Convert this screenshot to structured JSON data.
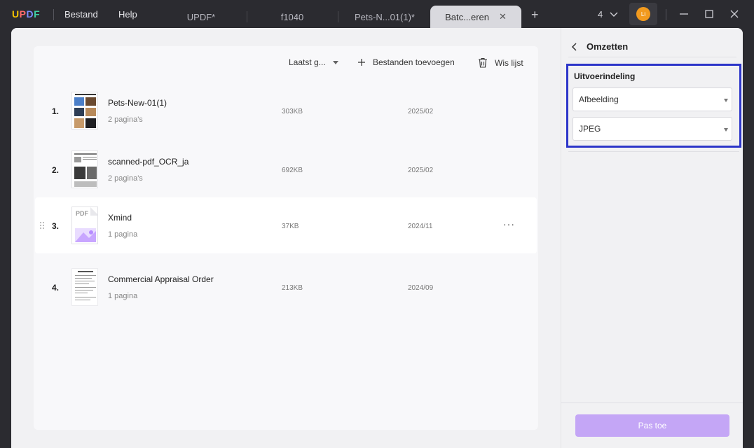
{
  "app": {
    "logo": "UPDF"
  },
  "menu": {
    "file": "Bestand",
    "help": "Help"
  },
  "tabs": [
    {
      "label": "UPDF*"
    },
    {
      "label": "f1040"
    },
    {
      "label": "Pets-N...01(1)*"
    },
    {
      "label": "Batc...eren"
    }
  ],
  "window": {
    "tab_count": "4",
    "avatar_initials": "Li"
  },
  "toolbar": {
    "sort_label": "Laatst g...",
    "add_files": "Bestanden toevoegen",
    "clear_list": "Wis lijst"
  },
  "files": [
    {
      "num": "1.",
      "name": "Pets-New-01(1)",
      "pages": "2 pagina's",
      "size": "303KB",
      "date": "2025/02"
    },
    {
      "num": "2.",
      "name": "scanned-pdf_OCR_ja",
      "pages": "2 pagina's",
      "size": "692KB",
      "date": "2025/02"
    },
    {
      "num": "3.",
      "name": "Xmind",
      "pages": "1 pagina",
      "size": "37KB",
      "date": "2024/11",
      "thumb_label": "PDF"
    },
    {
      "num": "4.",
      "name": "Commercial Appraisal Order",
      "pages": "1 pagina",
      "size": "213KB",
      "date": "2024/09"
    }
  ],
  "panel": {
    "title": "Omzetten",
    "output_label": "Uitvoerindeling",
    "format_select": "Afbeelding",
    "type_select": "JPEG",
    "apply": "Pas toe"
  },
  "colors": {
    "highlight_border": "#2c35c9",
    "apply_button": "#c4a6f6",
    "accent_orange": "#f29a1e"
  },
  "icons": [
    "back-chevron-icon",
    "plus-icon",
    "trash-icon",
    "more-icon",
    "drag-grip-icon",
    "minimize-icon",
    "maximize-icon",
    "close-icon"
  ]
}
